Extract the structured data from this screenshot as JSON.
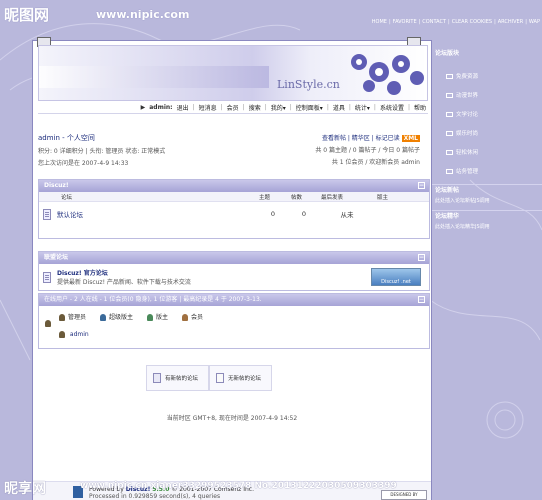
{
  "watermark": {
    "site": "昵图网",
    "url": "www.nipic.com",
    "bottom_site": "昵享网",
    "bottom_url": "www.nipic.cn",
    "bottom_id": "xianer33299523578 No.20131222030509303399",
    "designed_by": "DESIGNED BY LINSTYLE.CN"
  },
  "top_links": [
    "HOME",
    "FAVORITE",
    "CONTACT",
    "CLEAR COOKIES",
    "ARCHIVER",
    "WAP"
  ],
  "banner": {
    "logo": "LinStyle.cn"
  },
  "userbar": {
    "user": "admin:",
    "items": [
      "退出",
      "短消息",
      "会员",
      "搜索",
      "我的▾",
      "控制面板▾",
      "道具",
      "统计▾",
      "系统设置",
      "帮助"
    ]
  },
  "welcome": {
    "title": "admin - 个人空间",
    "line1": "积分: 0 详细积分 | 头衔: 管理员 状态: 正常模式",
    "line2": "您上次访问是在 2007-4-9 14:33",
    "right1": "查看新帖 | 精华区 | 标记已读",
    "xml": "XML",
    "right2": "共 0 篇主题 / 0 篇帖子 / 今日 0 篇帖子",
    "right3": "共 1 位会员 / 欢迎新会员 admin"
  },
  "discuz_block": {
    "title": "Discuz!",
    "columns": [
      "论坛",
      "主题",
      "帖数",
      "最后发表",
      "版主"
    ],
    "forum": {
      "name": "默认论坛",
      "topics": "0",
      "posts": "0",
      "last": "从未",
      "mods": ""
    }
  },
  "league": {
    "title": "联盟论坛",
    "name": "Discuz! 官方论坛",
    "desc": "提供最新 Discuz! 产品新闻、软件下载与技术交流",
    "badge": "Discuz! .net"
  },
  "online": {
    "header": "在线用户 - 2 人在线 - 1 位会员(0 隐身), 1 位游客 | 最高纪录是 4 于 2007-3-13.",
    "legend": [
      "管理员",
      "超级版主",
      "版主",
      "会员"
    ],
    "users": [
      "admin"
    ]
  },
  "buttons": {
    "new_posts": "有新帖的论坛",
    "no_new": "无新帖的论坛"
  },
  "timezone": "当前时区 GMT+8, 现在时间是 2007-4-9 14:52",
  "footer": {
    "powered_prefix": "Powered by",
    "powered_name": "Discuz!",
    "version": "5.5.0",
    "copyright": "© 2001-2007 Comsenz Inc.",
    "processed": "Processed in 0.929859 second(s), 4 queries"
  },
  "sidebar": {
    "title1": "论坛版块",
    "items": [
      "免费资源",
      "动漫世界",
      "文学讨论",
      "娱乐时尚",
      "轻松休闲",
      "站务管理"
    ],
    "title2": "论坛新帖",
    "cap2": "此处插入论坛新帖JS调用",
    "title3": "论坛精华",
    "cap3": "此处插入论坛精华JS调用"
  },
  "colors": {
    "header_purple": "#a6a3d6",
    "background": "#b9b8dc",
    "accent_orange": "#f08000"
  }
}
